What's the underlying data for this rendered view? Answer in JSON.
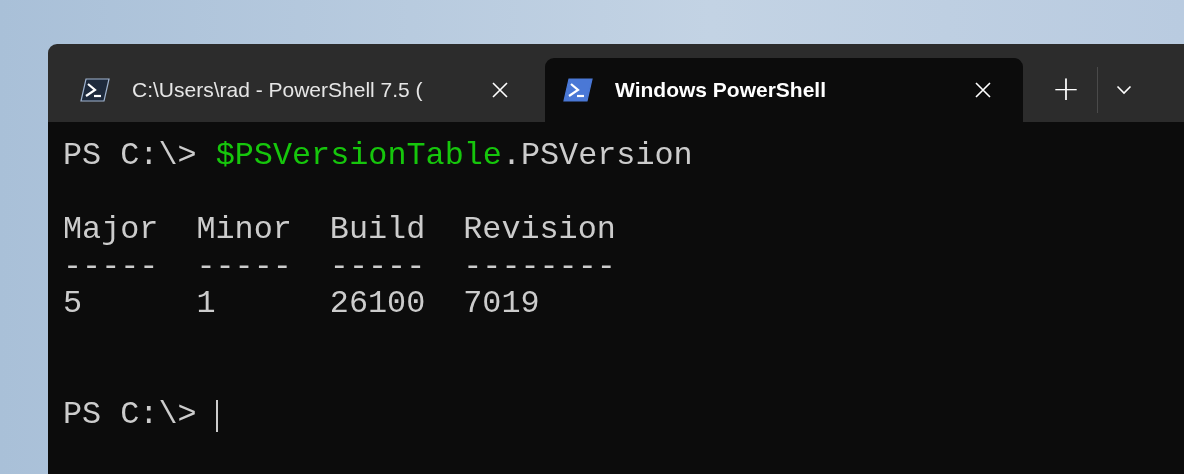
{
  "tabs": [
    {
      "title": "C:\\Users\\rad - PowerShell 7.5 (",
      "selected": false,
      "kind": "core"
    },
    {
      "title": "Windows PowerShell",
      "selected": true,
      "kind": "desktop"
    }
  ],
  "new_tab_button": "+",
  "terminal": {
    "command_line": {
      "prompt": "PS C:\\>",
      "segments": [
        {
          "text": "$PSVersionTable",
          "kind": "variable"
        },
        {
          "text": ".PSVersion",
          "kind": "member"
        }
      ]
    },
    "output_table": {
      "columns": [
        {
          "header": "Major",
          "rule": "-----",
          "value": "5"
        },
        {
          "header": "Minor",
          "rule": "-----",
          "value": "1"
        },
        {
          "header": "Build",
          "rule": "-----",
          "value": "26100"
        },
        {
          "header": "Revision",
          "rule": "--------",
          "value": "7019"
        }
      ]
    },
    "current_prompt": {
      "prompt": "PS C:\\>",
      "cursor": true
    }
  }
}
